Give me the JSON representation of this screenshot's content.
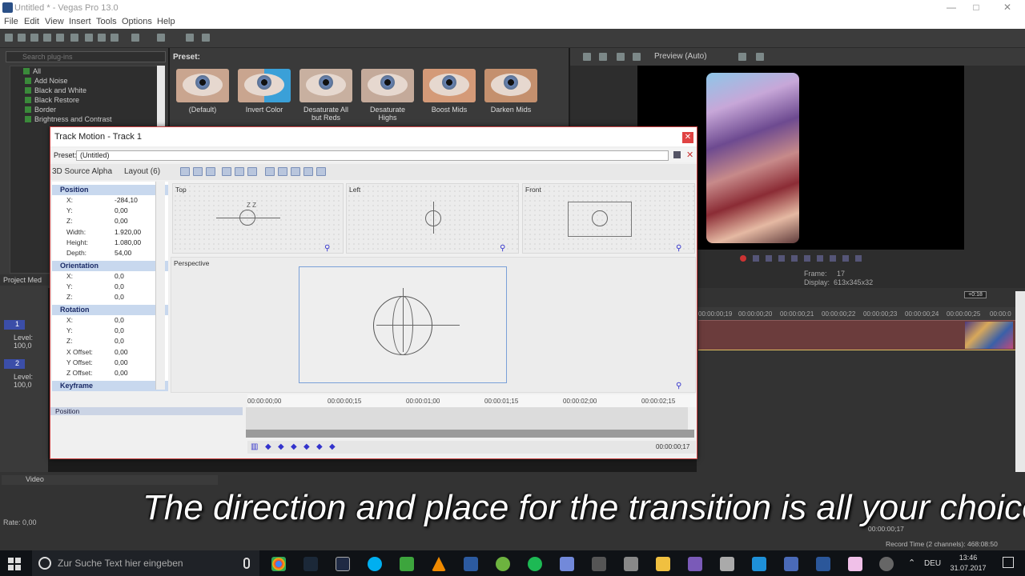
{
  "window": {
    "title": "Untitled * - Vegas Pro 13.0"
  },
  "menu": [
    "File",
    "Edit",
    "View",
    "Insert",
    "Tools",
    "Options",
    "Help"
  ],
  "explorer": {
    "search_placeholder": "Search plug-ins",
    "tree_root": "All",
    "items": [
      "Add Noise",
      "Black and White",
      "Black Restore",
      "Border",
      "Brightness and Contrast"
    ],
    "project_media_tab": "Project Med"
  },
  "presets": {
    "label": "Preset:",
    "items": [
      "(Default)",
      "Invert Color",
      "Desaturate All but Reds",
      "Desaturate Highs",
      "Boost Mids",
      "Darken Mids"
    ]
  },
  "preview": {
    "mode": "Preview (Auto)",
    "frame_label": "Frame:",
    "frame_value": "17",
    "display_label": "Display:",
    "display_value": "613x345x32"
  },
  "timeline": {
    "duration_badge": "+0:18",
    "ticks": [
      "00:00:00;19",
      "00:00:00;20",
      "00:00:00;21",
      "00:00:00;22",
      "00:00:00;23",
      "00:00:00;24",
      "00:00:00;25",
      "00:00:0"
    ]
  },
  "tracks": [
    {
      "number": "1",
      "level": "Level: 100,0"
    },
    {
      "number": "2",
      "level": "Level: 100,0"
    }
  ],
  "dialog": {
    "title": "Track Motion - Track 1",
    "preset_label": "Preset:",
    "preset_value": "(Untitled)",
    "source_alpha": "3D Source Alpha",
    "layout": "Layout (6)",
    "sections": {
      "position": {
        "title": "Position",
        "rows": [
          {
            "k": "X:",
            "v": "-284,10"
          },
          {
            "k": "Y:",
            "v": "0,00"
          },
          {
            "k": "Z:",
            "v": "0,00"
          },
          {
            "k": "Width:",
            "v": "1.920,00"
          },
          {
            "k": "Height:",
            "v": "1.080,00"
          },
          {
            "k": "Depth:",
            "v": "54,00"
          }
        ]
      },
      "orientation": {
        "title": "Orientation",
        "rows": [
          {
            "k": "X:",
            "v": "0,0"
          },
          {
            "k": "Y:",
            "v": "0,0"
          },
          {
            "k": "Z:",
            "v": "0,0"
          }
        ]
      },
      "rotation": {
        "title": "Rotation",
        "rows": [
          {
            "k": "X:",
            "v": "0,0"
          },
          {
            "k": "Y:",
            "v": "0,0"
          },
          {
            "k": "Z:",
            "v": "0,0"
          },
          {
            "k": "X Offset:",
            "v": "0,00"
          },
          {
            "k": "Y Offset:",
            "v": "0,00"
          },
          {
            "k": "Z Offset:",
            "v": "0,00"
          }
        ]
      },
      "keyframe": {
        "title": "Keyframe"
      }
    },
    "views": {
      "top": "Top",
      "left": "Left",
      "front": "Front",
      "perspective": "Perspective"
    },
    "timeline_ticks": [
      "00:00:00;00",
      "00:00:00;15",
      "00:00:01;00",
      "00:00:01;15",
      "00:00:02;00",
      "00:00:02;15"
    ],
    "keyframe_row": "Position",
    "cursor_time": "00:00:00;17"
  },
  "lower": {
    "video_label": "Video",
    "rate": "Rate: 0,00",
    "cursor_time": "00:00:00;17",
    "record_time": "Record Time (2 channels): 468:08:50"
  },
  "caption": "The direction and place for the transition is all your choice",
  "taskbar": {
    "search_placeholder": "Zur Suche Text hier eingeben",
    "language": "DEU",
    "time": "13:46",
    "date": "31.07.2017"
  },
  "colors": {
    "dialog_border": "#cc4444",
    "event": "#6b3c3c",
    "section_header": "#c8d8ee"
  }
}
